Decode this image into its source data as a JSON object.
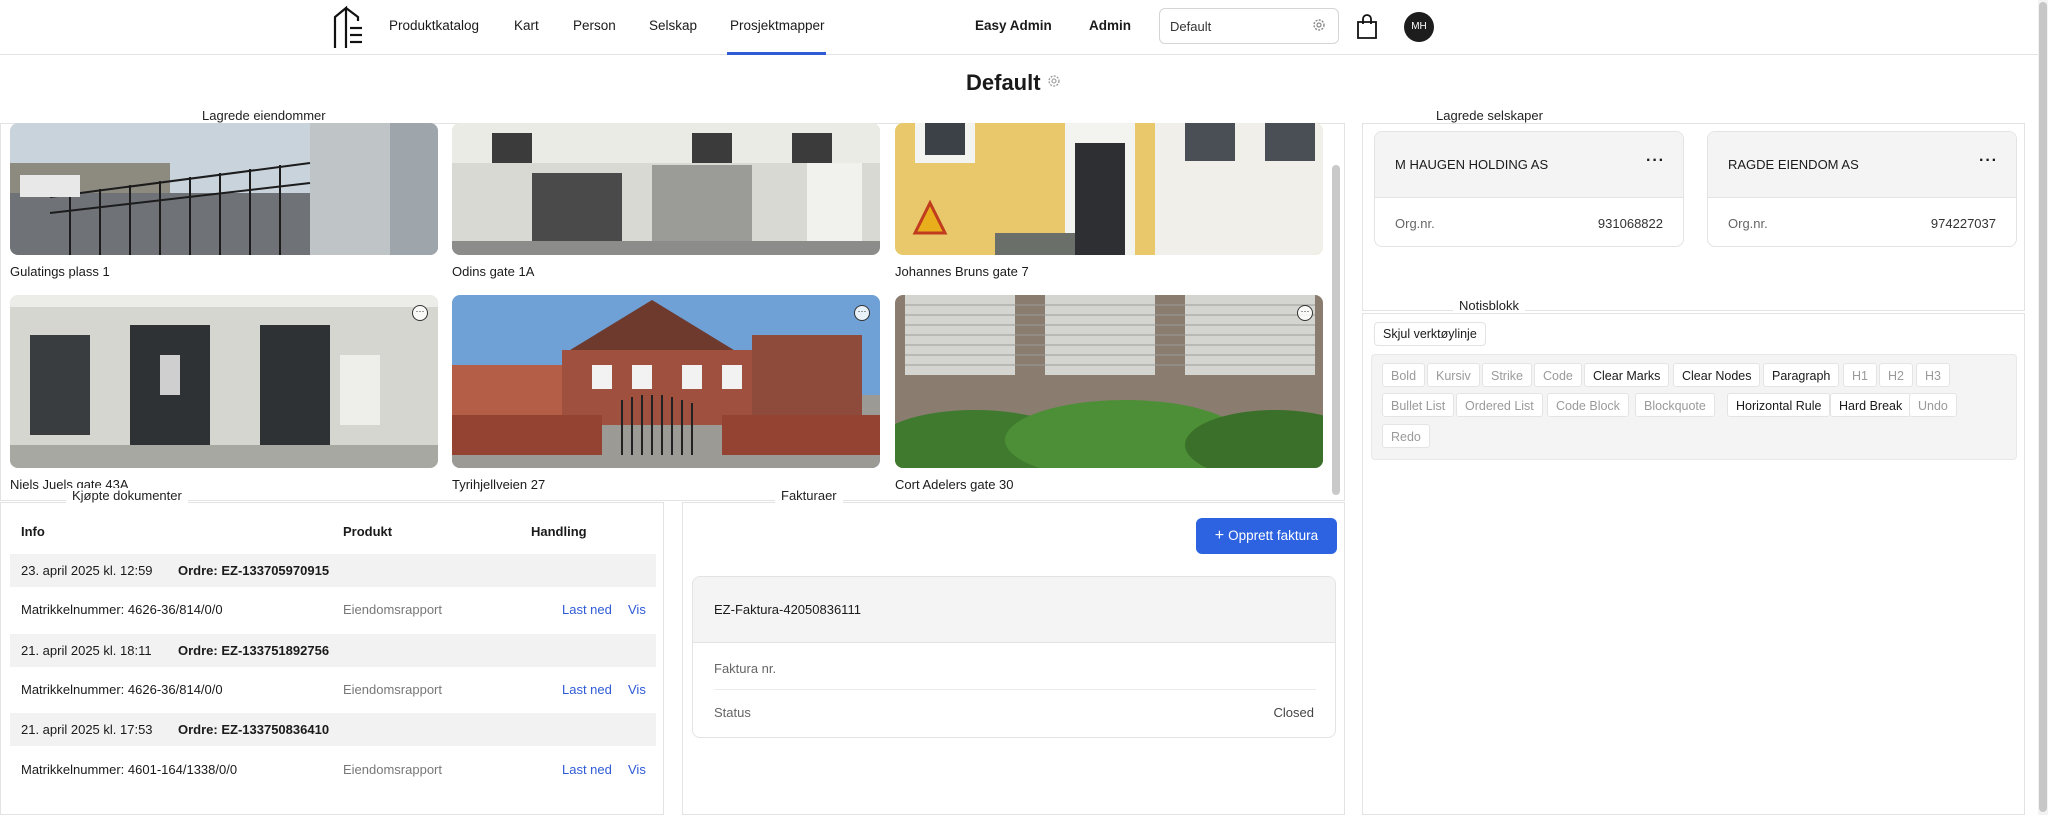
{
  "nav": {
    "items": [
      "Produktkatalog",
      "Kart",
      "Person",
      "Selskap",
      "Prosjektmapper"
    ],
    "easy_admin": "Easy Admin",
    "admin": "Admin",
    "project_value": "Default",
    "avatar_initials": "MH",
    "accent": "#2f5bd6"
  },
  "page": {
    "title": "Default"
  },
  "properties": {
    "legend": "Lagrede eiendommer",
    "items": [
      {
        "label": "Gulatings plass 1"
      },
      {
        "label": "Odins gate 1A"
      },
      {
        "label": "Johannes Bruns gate 7"
      },
      {
        "label": "Niels Juels gate 43A"
      },
      {
        "label": "Tyrihjellveien 27"
      },
      {
        "label": "Cort Adelers gate 30"
      }
    ]
  },
  "documents": {
    "legend": "Kjøpte dokumenter",
    "headers": {
      "info": "Info",
      "product": "Produkt",
      "action": "Handling"
    },
    "orders": [
      {
        "date": "23. april 2025 kl. 12:59",
        "order": "Ordre: EZ-133705970915",
        "matrikkel": "Matrikkelnummer: 4626-36/814/0/0",
        "product": "Eiendomsrapport"
      },
      {
        "date": "21. april 2025 kl. 18:11",
        "order": "Ordre: EZ-133751892756",
        "matrikkel": "Matrikkelnummer: 4626-36/814/0/0",
        "product": "Eiendomsrapport"
      },
      {
        "date": "21. april 2025 kl. 17:53",
        "order": "Ordre: EZ-133750836410",
        "matrikkel": "Matrikkelnummer: 4601-164/1338/0/0",
        "product": "Eiendomsrapport"
      }
    ],
    "download": "Last ned",
    "view": "Vis"
  },
  "invoices": {
    "legend": "Fakturaer",
    "create_button": "Opprett faktura",
    "items": [
      {
        "title": "EZ-Faktura-42050836111",
        "number_label": "Faktura nr.",
        "status_label": "Status",
        "status": "Closed"
      }
    ]
  },
  "companies": {
    "legend": "Lagrede selskaper",
    "items": [
      {
        "name": "M HAUGEN HOLDING AS",
        "org_label": "Org.nr.",
        "org": "931068822"
      },
      {
        "name": "RAGDE EIENDOM AS",
        "org_label": "Org.nr.",
        "org": "974227037"
      }
    ]
  },
  "notes": {
    "legend": "Notisblokk",
    "hide_toolbar": "Skjul verktøylinje",
    "toolbar": {
      "row1": [
        "Bold",
        "Kursiv",
        "Strike",
        "Code",
        "Clear Marks",
        "Clear Nodes",
        "Paragraph",
        "H1",
        "H2",
        "H3"
      ],
      "row2": [
        "Bullet List",
        "Ordered List",
        "Code Block",
        "Blockquote",
        "Horizontal Rule",
        "Hard Break",
        "Undo"
      ],
      "row3": [
        "Redo"
      ]
    }
  }
}
